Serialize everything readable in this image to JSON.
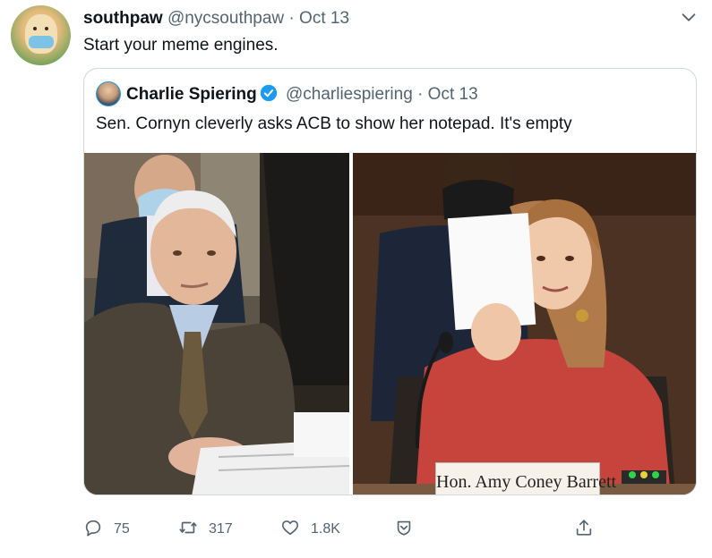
{
  "tweet": {
    "author_name": "southpaw",
    "handle": "@nycsouthpaw",
    "separator": "·",
    "date": "Oct 13",
    "text": "Start your meme engines."
  },
  "quoted_tweet": {
    "author_name": "Charlie Spiering",
    "handle": "@charliespiering",
    "separator": "·",
    "date": "Oct 13",
    "text": "Sen. Cornyn cleverly asks ACB to show her notepad. It's empty",
    "media": {
      "nameplate_text": "Hon. Amy Coney Barrett"
    }
  },
  "actions": {
    "reply_count": "75",
    "retweet_count": "317",
    "like_count": "1.8K"
  },
  "colors": {
    "verified": "#1d9bf0",
    "secondary_text": "#536471",
    "border": "#cfd9de"
  }
}
